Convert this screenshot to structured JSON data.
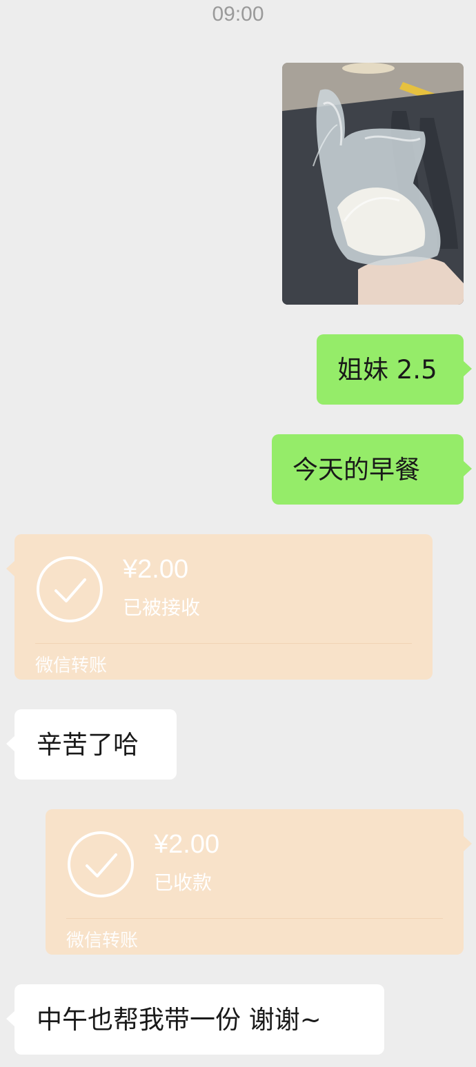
{
  "time": "09:00",
  "messages": {
    "m1": "姐妹 2.5",
    "m2": "今天的早餐",
    "m3": "辛苦了哈",
    "m4": "中午也帮我带一份 谢谢~"
  },
  "transfers": {
    "t1": {
      "amount": "¥2.00",
      "status": "已被接收",
      "footer": "微信转账"
    },
    "t2": {
      "amount": "¥2.00",
      "status": "已收款",
      "footer": "微信转账"
    }
  },
  "colors": {
    "background": "#ededed",
    "outgoing_bubble": "#95ec69",
    "incoming_bubble": "#ffffff",
    "transfer_card": "#f8e2c9"
  },
  "icons": [
    "check-circle-icon"
  ]
}
